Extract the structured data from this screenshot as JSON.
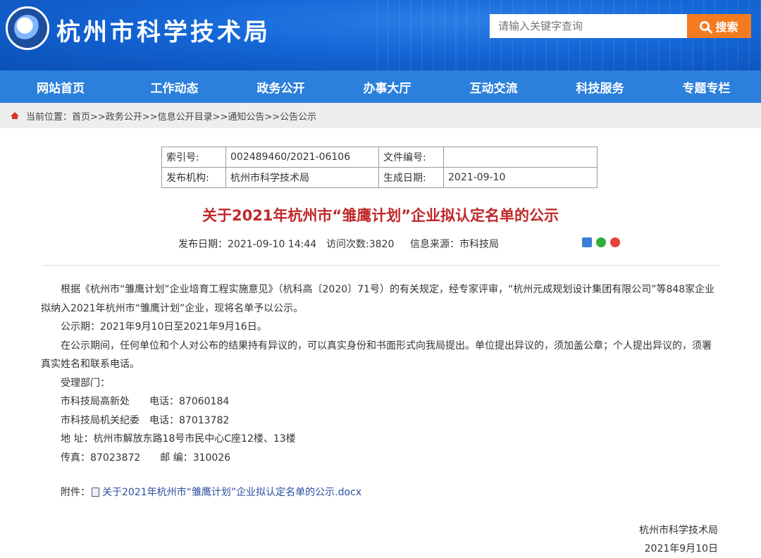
{
  "header": {
    "site_title": "杭州市科学技术局",
    "search_placeholder": "请输入关键字查询",
    "search_button": "搜索"
  },
  "nav": [
    "网站首页",
    "工作动态",
    "政务公开",
    "办事大厅",
    "互动交流",
    "科技服务",
    "专题专栏"
  ],
  "breadcrumb": "当前位置：首页>>政务公开>>信息公开目录>>通知公告>>公告公示",
  "meta": {
    "index_label": "索引号:",
    "index_value": "002489460/2021-06106",
    "docno_label": "文件编号:",
    "docno_value": "",
    "org_label": "发布机构:",
    "org_value": "杭州市科学技术局",
    "date_label": "生成日期:",
    "date_value": "2021-09-10"
  },
  "article": {
    "title": "关于2021年杭州市“雏鹰计划”企业拟认定名单的公示",
    "publish": "发布日期：2021-09-10 14:44",
    "visits": "访问次数:3820",
    "source": "信息来源：市科技局",
    "para1": "根据《杭州市“雏鹰计划”企业培育工程实施意见》（杭科高〔2020〕71号）的有关规定，经专家评审，“杭州元成规划设计集团有限公司”等848家企业拟纳入2021年杭州市“雏鹰计划”企业，现将名单予以公示。",
    "para2": "公示期：2021年9月10日至2021年9月16日。",
    "para3": "在公示期间，任何单位和个人对公布的结果持有异议的，可以真实身份和书面形式向我局提出。单位提出异议的，须加盖公章；个人提出异议的，须署真实姓名和联系电话。",
    "para4": "受理部门：",
    "dept1": "市科技局高新处　　电话：87060184",
    "dept2": "市科技局机关纪委　电话：87013782",
    "address": "地 址：杭州市解放东路18号市民中心C座12楼、13楼",
    "fax": "传真：87023872　　邮 编：310026",
    "attach_label": "附件：",
    "attach_file": "关于2021年杭州市“雏鹰计划”企业拟认定名单的公示.docx",
    "sign_org": "杭州市科学技术局",
    "sign_date": "2021年9月10日"
  }
}
